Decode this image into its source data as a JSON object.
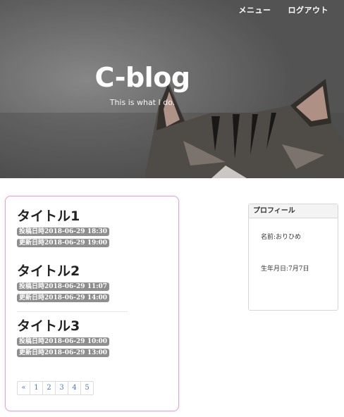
{
  "nav": {
    "menu_label": "メニュー",
    "logout_label": "ログアウト"
  },
  "hero": {
    "title": "C-blog",
    "subtitle": "This is what I do."
  },
  "posts": [
    {
      "title": "タイトル1",
      "posted": "投稿日時2018-06-29 18:30",
      "updated": "更新日時2018-06-29 19:00"
    },
    {
      "title": "タイトル2",
      "posted": "投稿日時2018-06-29 11:07",
      "updated": "更新日時2018-06-29 14:00"
    },
    {
      "title": "タイトル3",
      "posted": "投稿日時2018-06-29 10:00",
      "updated": "更新日時2018-06-29 13:00"
    }
  ],
  "pagination": {
    "prev": "«",
    "pages": [
      "1",
      "2",
      "3",
      "4",
      "5"
    ]
  },
  "profile": {
    "heading": "プロフィール",
    "name": "名前:おりひめ",
    "birthday": "生年月日:7月7日"
  },
  "colors": {
    "accent_border": "#d8a8d8",
    "badge": "#8e8e8e",
    "link": "#4a78b8"
  }
}
